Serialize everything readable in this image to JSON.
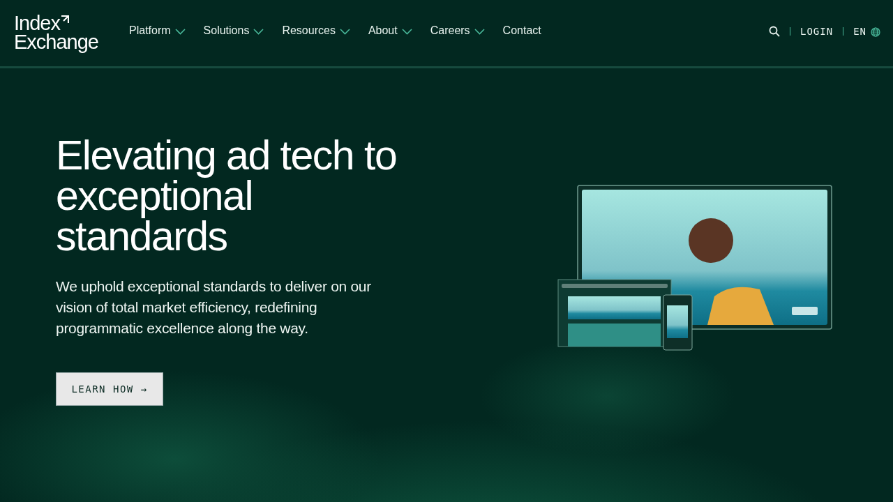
{
  "header": {
    "logo": {
      "line_1": "Index",
      "line_2": "Exchange"
    },
    "nav": [
      {
        "label": "Platform",
        "has_dropdown": true
      },
      {
        "label": "Solutions",
        "has_dropdown": true
      },
      {
        "label": "Resources",
        "has_dropdown": true
      },
      {
        "label": "About",
        "has_dropdown": true
      },
      {
        "label": "Careers",
        "has_dropdown": true
      },
      {
        "label": "Contact",
        "has_dropdown": false
      }
    ],
    "login": "LOGIN",
    "language": "EN"
  },
  "hero": {
    "title": "Elevating ad tech to exceptional standards",
    "text": "We uphold exceptional standards to deliver on our vision of total market efficiency, redefining programmatic excellence along the way.",
    "button": "LEARN HOW →"
  }
}
